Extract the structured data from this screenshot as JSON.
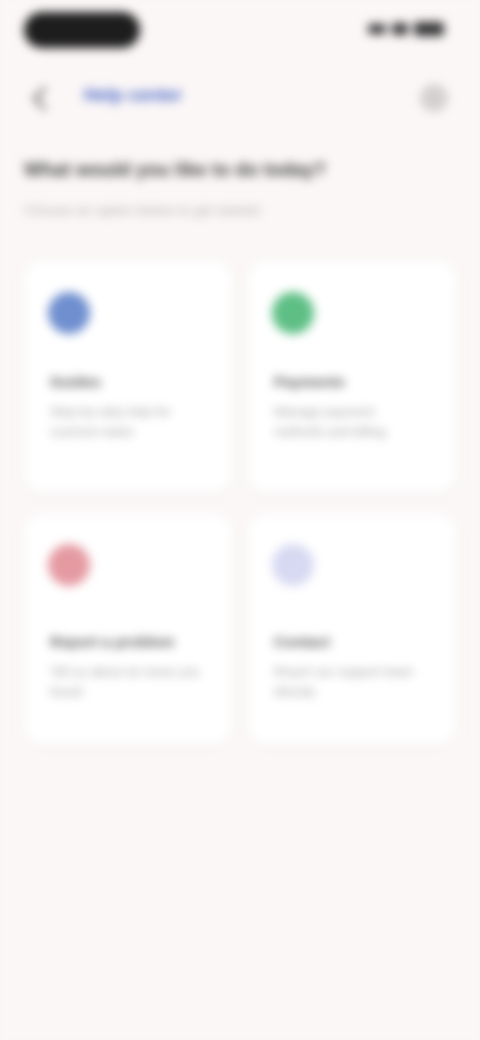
{
  "app": {
    "nav_title": "Help center"
  },
  "page": {
    "heading": "What would you like to do today?",
    "subheading": "Choose an option below to get started"
  },
  "cards": [
    {
      "title": "Guides",
      "description": "Step-by-step help for common tasks",
      "icon": "book-icon",
      "color": "#6f8fcf"
    },
    {
      "title": "Payments",
      "description": "Manage payment methods and billing",
      "icon": "wallet-icon",
      "color": "#5ebf85"
    },
    {
      "title": "Report a problem",
      "description": "Tell us about an issue you found",
      "icon": "alert-icon",
      "color": "#e59aa2"
    },
    {
      "title": "Contact",
      "description": "Reach our support team directly",
      "icon": "chat-icon",
      "color": "#d7d9f2"
    }
  ],
  "colors": {
    "background": "#fbf7f7",
    "accent": "#4562c2"
  }
}
